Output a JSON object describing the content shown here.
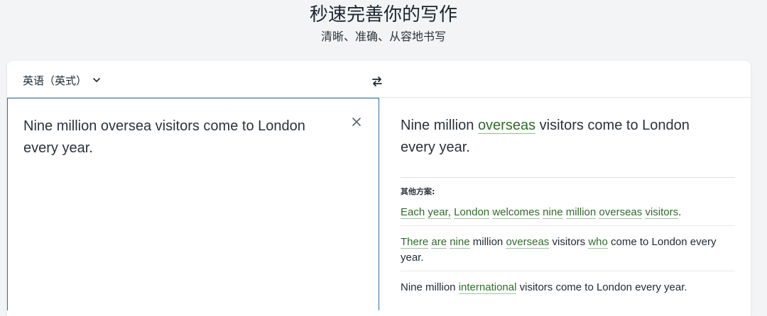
{
  "header": {
    "title": "秒速完善你的写作",
    "subtitle": "清晰、准确、从容地书写"
  },
  "toolbar": {
    "language": "英语（英式）"
  },
  "input": {
    "text": "Nine million oversea visitors come to London every year."
  },
  "output": {
    "segments": [
      {
        "t": "Nine million ",
        "h": false
      },
      {
        "t": "overseas",
        "h": true
      },
      {
        "t": " visitors come to London every year.",
        "h": false
      }
    ]
  },
  "alternatives": {
    "title": "其他方案:",
    "items": [
      {
        "segments": [
          {
            "t": "Each",
            "h": true
          },
          {
            "t": " ",
            "h": false
          },
          {
            "t": "year,",
            "h": true
          },
          {
            "t": " ",
            "h": false
          },
          {
            "t": "London",
            "h": true
          },
          {
            "t": " ",
            "h": false
          },
          {
            "t": "welcomes",
            "h": true
          },
          {
            "t": " ",
            "h": false
          },
          {
            "t": "nine",
            "h": true
          },
          {
            "t": " ",
            "h": false
          },
          {
            "t": "million",
            "h": true
          },
          {
            "t": " ",
            "h": false
          },
          {
            "t": "overseas",
            "h": true
          },
          {
            "t": " ",
            "h": false
          },
          {
            "t": "visitors",
            "h": true
          },
          {
            "t": ".",
            "h": false
          }
        ]
      },
      {
        "segments": [
          {
            "t": "There",
            "h": true
          },
          {
            "t": " ",
            "h": false
          },
          {
            "t": "are",
            "h": true
          },
          {
            "t": " ",
            "h": false
          },
          {
            "t": "nine",
            "h": true
          },
          {
            "t": " million ",
            "h": false
          },
          {
            "t": "overseas",
            "h": true
          },
          {
            "t": " visitors ",
            "h": false
          },
          {
            "t": "who",
            "h": true
          },
          {
            "t": " come to London every year.",
            "h": false
          }
        ]
      },
      {
        "segments": [
          {
            "t": "Nine million ",
            "h": false
          },
          {
            "t": "international",
            "h": true
          },
          {
            "t": " visitors come to London every year.",
            "h": false
          }
        ]
      }
    ]
  },
  "icons": {
    "chevron": "chevron-down-icon",
    "swap": "swap-arrows-icon",
    "clear": "close-icon"
  },
  "colors": {
    "accent_border": "#2e6ea8",
    "highlight_text": "#2f6b2a",
    "highlight_underline": "#8fbf8a"
  }
}
